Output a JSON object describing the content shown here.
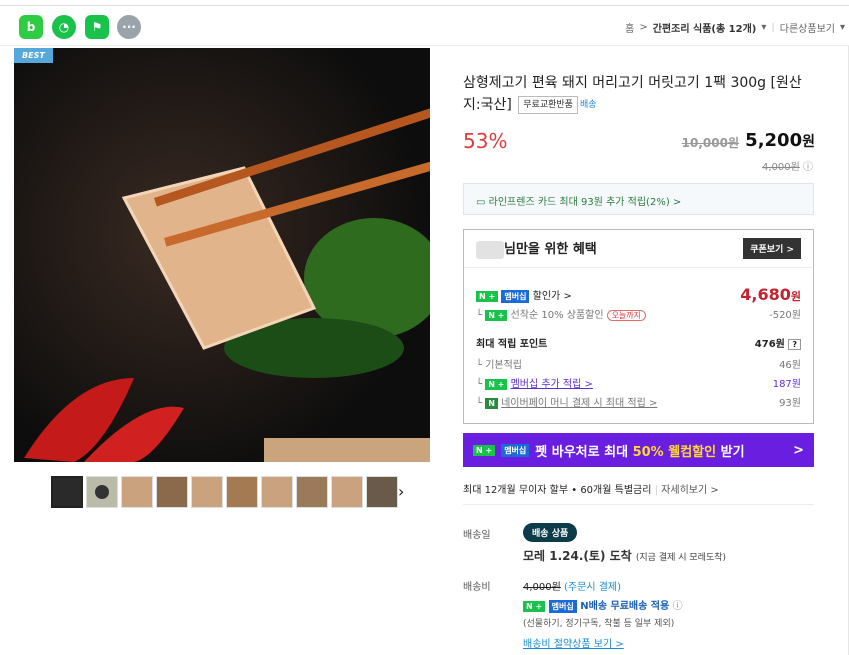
{
  "topbar": {
    "icons": [
      "b",
      "◔",
      "⚑",
      "···"
    ],
    "icon_colors": [
      "#2ecc40",
      "#19c24b",
      "#19c24b",
      "#9aa3aa"
    ],
    "breadcrumb": {
      "home": "홈",
      "sep": ">",
      "category": "간편조리 식품(총 12개)",
      "other": "다른상품보기"
    }
  },
  "product": {
    "badge": "BEST",
    "title": "삼형제고기 편육 돼지 머리고기 머릿고기 1팩 300g [원산지:국산]",
    "tag": "무료교환반품",
    "n_delivery": "배송",
    "discount": "53%",
    "original_price": "10,000원",
    "price": "5,200",
    "price_unit": "원",
    "sub_price": "4,000원"
  },
  "card_promo": "라인프렌즈 카드 최대 93원 추가 적립(2%) >",
  "benefit": {
    "title": "님만을 위한 혜택",
    "coupon_button": "쿠폰보기 >",
    "sale_label": "할인가 >",
    "sale_price": "4,680",
    "sale_unit": "원",
    "first_label": "선착순 10% 상품할인",
    "first_pill": "오늘까지",
    "first_value": "-520원",
    "points_label": "최대 적립 포인트",
    "points_value": "476원",
    "points_help": "?",
    "basic_label": "기본적립",
    "basic_value": "46원",
    "member_label": "멤버십 추가 적립 >",
    "member_value": "187원",
    "naverpay_label": "네이버페이 머니 결제 시 최대 적립 >",
    "naverpay_value": "93원",
    "membership_tag": "멤버십",
    "npay_icon": "N"
  },
  "purple_banner": {
    "prefix": "펫 바우처로 최대 ",
    "highlight": "50% 웰컴할인",
    "suffix": " 받기",
    "arrow": ">"
  },
  "installment": "최대 12개월 무이자 할부 • 60개월 특별금리",
  "installment_link": "자세히보기 >",
  "delivery": {
    "day_label": "배송일",
    "badge": "배송 상품",
    "date": "모레 1.24.(토) 도착",
    "date_note": "(지금 결제 시 모레도착)",
    "fee_label": "배송비",
    "fee_old": "4,000원",
    "fee_note": "(주문시 결제)",
    "free_label": "N배송 무료배송 적용",
    "exclude": "(선물하기, 정기구독, 착불 등 일부 제외)",
    "saving_link": "배송비 절약상품 보기 >"
  }
}
